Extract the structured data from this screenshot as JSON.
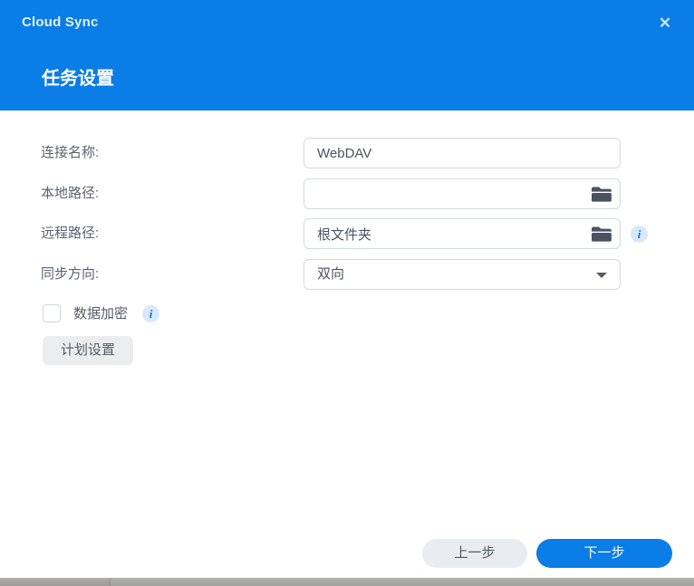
{
  "header": {
    "app_title": "Cloud Sync",
    "page_title": "任务设置",
    "close_glyph": "✕"
  },
  "form": {
    "fields": [
      {
        "label": "连接名称:",
        "value": "WebDAV",
        "type": "text"
      },
      {
        "label": "本地路径:",
        "value": "",
        "type": "folder-picker"
      },
      {
        "label": "远程路径:",
        "value": "根文件夹",
        "type": "folder-picker",
        "has_info": true
      },
      {
        "label": "同步方向:",
        "value": "双向",
        "type": "select"
      }
    ],
    "encryption": {
      "label": "数据加密",
      "checked": false,
      "has_info": true
    },
    "schedule_button_label": "计划设置",
    "info_glyph": "i"
  },
  "footer": {
    "back_label": "上一步",
    "next_label": "下一步"
  },
  "colors": {
    "accent_blue": "#0a7de6",
    "field_border": "#d4d9e0",
    "label_text": "#5b6370",
    "value_text": "#4c5362",
    "info_bg": "#d7e9fb",
    "info_fg": "#1472e8"
  }
}
